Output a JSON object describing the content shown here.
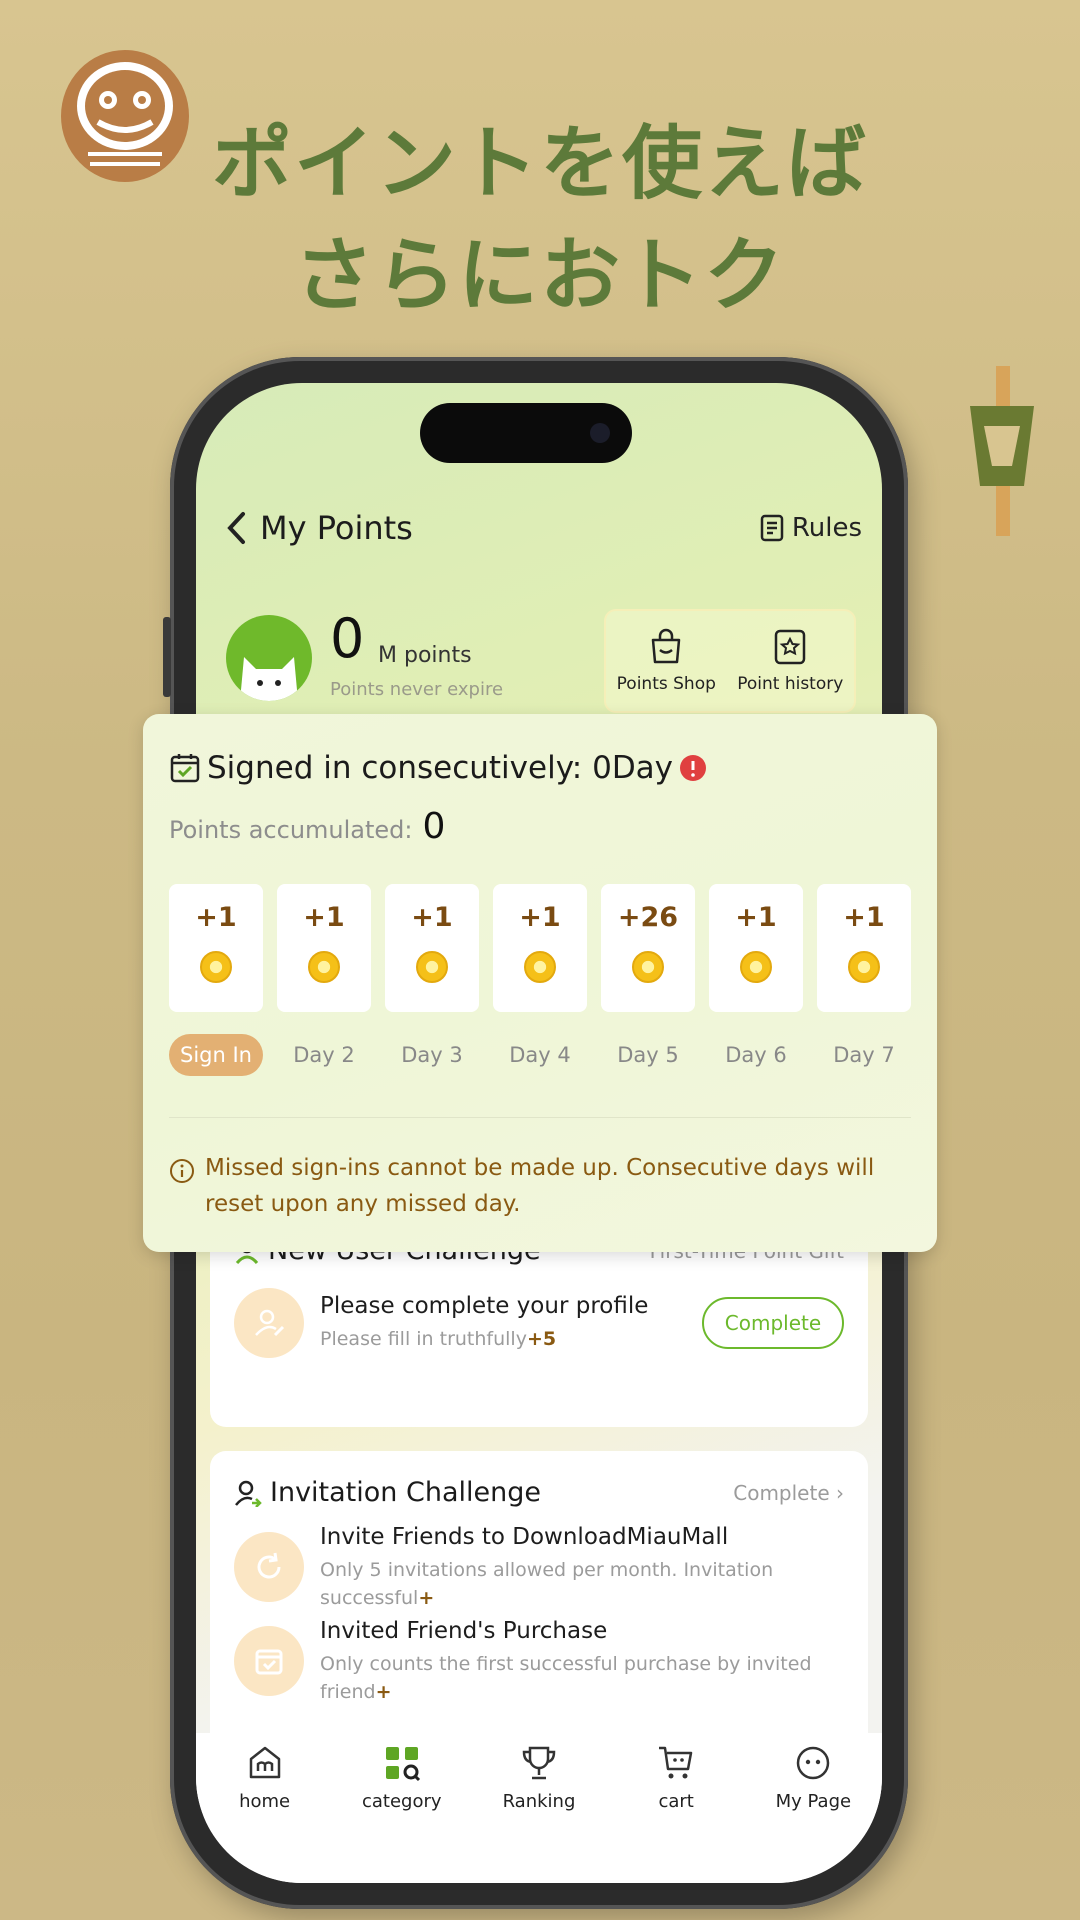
{
  "headline": {
    "line1": "ポイントを使えば",
    "line2": "さらにおトク"
  },
  "nav": {
    "back_icon": "chevron-left-icon",
    "title": "My Points",
    "rules_icon": "document-icon",
    "rules_label": "Rules"
  },
  "account": {
    "points": "0",
    "unit": "M points",
    "subtitle": "Points never expire",
    "shop_label": "Points Shop",
    "history_label": "Point history"
  },
  "signin": {
    "title": "Signed in consecutively: 0Day",
    "accumulated_label": "Points accumulated:",
    "accumulated_value": "0",
    "days": [
      {
        "reward": "+1",
        "label": "Sign In"
      },
      {
        "reward": "+1",
        "label": "Day 2"
      },
      {
        "reward": "+1",
        "label": "Day 3"
      },
      {
        "reward": "+1",
        "label": "Day 4"
      },
      {
        "reward": "+26",
        "label": "Day 5"
      },
      {
        "reward": "+1",
        "label": "Day 6"
      },
      {
        "reward": "+1",
        "label": "Day 7"
      }
    ],
    "note": "Missed sign-ins cannot be made up. Consecutive days will reset upon any missed day."
  },
  "new_user": {
    "title": "New User Challenge",
    "right": "First-Time Point Gift",
    "task_title": "Please complete your profile",
    "task_desc": "Please fill in truthfully",
    "task_bonus": "+5",
    "button": "Complete"
  },
  "invitation": {
    "title": "Invitation Challenge",
    "right": "Complete",
    "task1_title": "Invite Friends to DownloadMiauMall",
    "task1_desc": "Only 5 invitations allowed per month. Invitation successful",
    "task1_bonus": "+",
    "task2_title": "Invited Friend's Purchase",
    "task2_desc": "Only counts the first successful purchase by invited friend",
    "task2_bonus": "+"
  },
  "tabs": [
    {
      "label": "home",
      "icon": "home-icon"
    },
    {
      "label": "category",
      "icon": "grid-icon"
    },
    {
      "label": "Ranking",
      "icon": "trophy-icon"
    },
    {
      "label": "cart",
      "icon": "cart-icon"
    },
    {
      "label": "My Page",
      "icon": "face-icon"
    }
  ],
  "colors": {
    "brand_green": "#6cb92c",
    "headline_green": "#5d7a3a",
    "accent_orange": "#e3b073",
    "note_brown": "#8a5a12",
    "background_tan": "#ccb984"
  }
}
